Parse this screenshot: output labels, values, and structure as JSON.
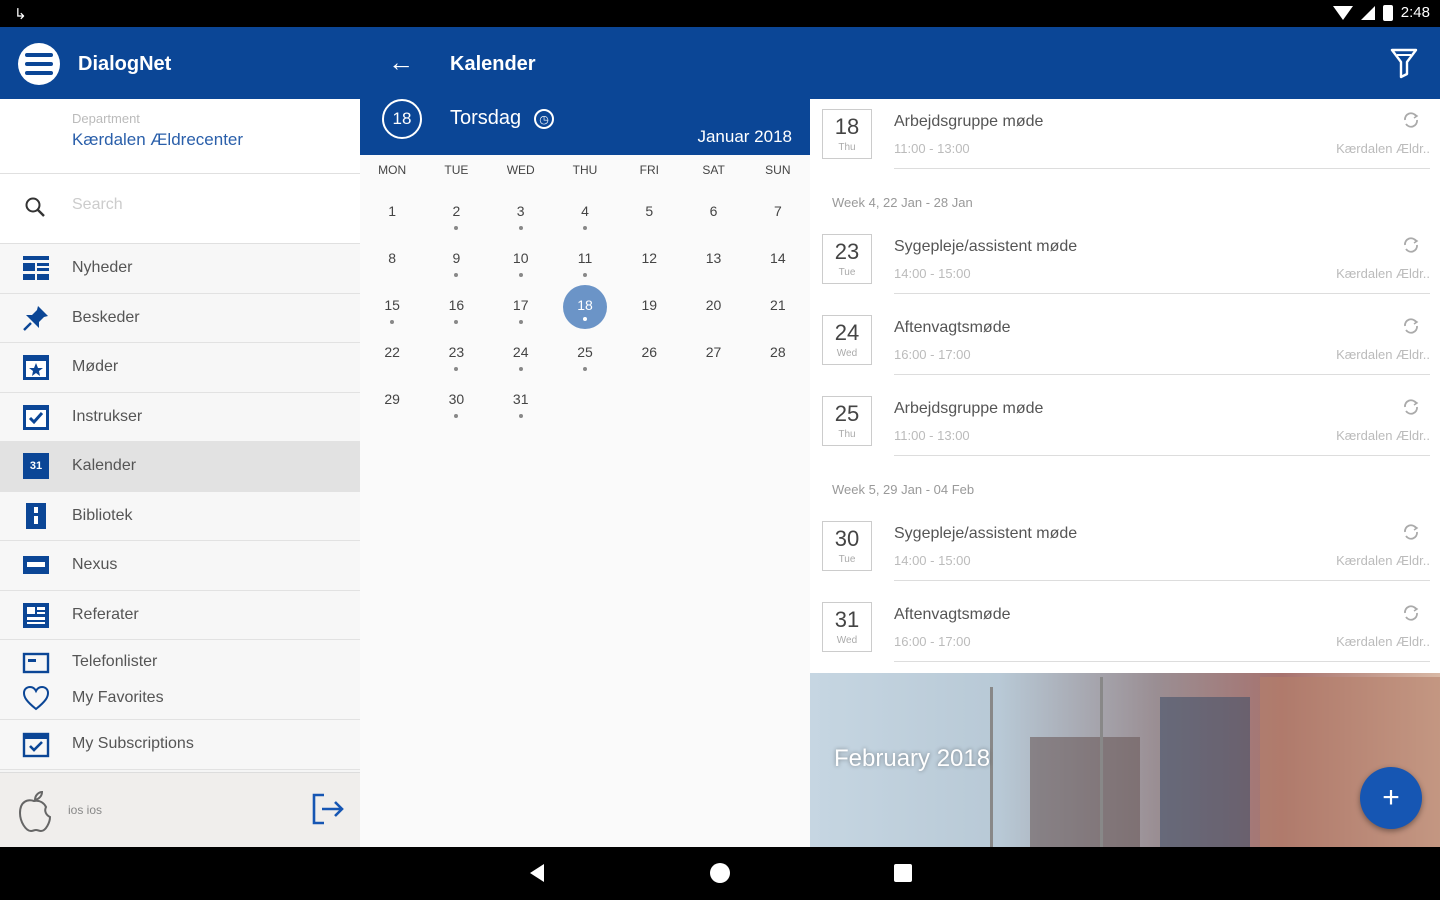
{
  "status": {
    "time": "2:48"
  },
  "app": {
    "name": "DialogNet",
    "page_title": "Kalender"
  },
  "sidebar": {
    "department_label": "Department",
    "department_value": "Kærdalen Ældrecenter",
    "search_placeholder": "Search",
    "items": [
      {
        "label": "Nyheder"
      },
      {
        "label": "Beskeder"
      },
      {
        "label": "Møder"
      },
      {
        "label": "Instrukser"
      },
      {
        "label": "Kalender",
        "active": true
      },
      {
        "label": "Bibliotek"
      },
      {
        "label": "Nexus"
      },
      {
        "label": "Referater"
      },
      {
        "label": "Telefonlister"
      },
      {
        "label": "My Favorites"
      },
      {
        "label": "My Subscriptions"
      }
    ],
    "user_name": "ios ios"
  },
  "calendar": {
    "selected_day": "18",
    "weekday": "Torsdag",
    "month": "Januar 2018",
    "dow": [
      "MON",
      "TUE",
      "WED",
      "THU",
      "FRI",
      "SAT",
      "SUN"
    ],
    "days": [
      {
        "d": "1",
        "dot": false
      },
      {
        "d": "2",
        "dot": true
      },
      {
        "d": "3",
        "dot": true
      },
      {
        "d": "4",
        "dot": true
      },
      {
        "d": "5",
        "dot": false
      },
      {
        "d": "6",
        "dot": false
      },
      {
        "d": "7",
        "dot": false
      },
      {
        "d": "8",
        "dot": false
      },
      {
        "d": "9",
        "dot": true
      },
      {
        "d": "10",
        "dot": true
      },
      {
        "d": "11",
        "dot": true
      },
      {
        "d": "12",
        "dot": false
      },
      {
        "d": "13",
        "dot": false
      },
      {
        "d": "14",
        "dot": false
      },
      {
        "d": "15",
        "dot": true
      },
      {
        "d": "16",
        "dot": true
      },
      {
        "d": "17",
        "dot": true
      },
      {
        "d": "18",
        "dot": true,
        "selected": true
      },
      {
        "d": "19",
        "dot": false
      },
      {
        "d": "20",
        "dot": false
      },
      {
        "d": "21",
        "dot": false
      },
      {
        "d": "22",
        "dot": false
      },
      {
        "d": "23",
        "dot": true
      },
      {
        "d": "24",
        "dot": true
      },
      {
        "d": "25",
        "dot": true
      },
      {
        "d": "26",
        "dot": false
      },
      {
        "d": "27",
        "dot": false
      },
      {
        "d": "28",
        "dot": false
      },
      {
        "d": "29",
        "dot": false
      },
      {
        "d": "30",
        "dot": true
      },
      {
        "d": "31",
        "dot": true
      }
    ]
  },
  "events": {
    "week_headers": [
      "Week 4, 22 Jan - 28 Jan",
      "Week 5, 29 Jan - 04 Feb"
    ],
    "items": [
      {
        "day": "18",
        "wd": "Thu",
        "title": "Arbejdsgruppe møde",
        "time": "11:00 - 13:00",
        "location": "Kærdalen Ældr.."
      },
      {
        "day": "23",
        "wd": "Tue",
        "title": "Sygepleje/assistent møde",
        "time": "14:00 - 15:00",
        "location": "Kærdalen Ældr.."
      },
      {
        "day": "24",
        "wd": "Wed",
        "title": "Aftenvagtsmøde",
        "time": "16:00 - 17:00",
        "location": "Kærdalen Ældr.."
      },
      {
        "day": "25",
        "wd": "Thu",
        "title": "Arbejdsgruppe møde",
        "time": "11:00 - 13:00",
        "location": "Kærdalen Ældr.."
      },
      {
        "day": "30",
        "wd": "Tue",
        "title": "Sygepleje/assistent møde",
        "time": "14:00 - 15:00",
        "location": "Kærdalen Ældr.."
      },
      {
        "day": "31",
        "wd": "Wed",
        "title": "Aftenvagtsmøde",
        "time": "16:00 - 17:00",
        "location": "Kærdalen Ældr.."
      }
    ],
    "banner_label": "February 2018"
  },
  "colors": {
    "primary": "#0b4696",
    "selected_day": "#6b94c7",
    "fab": "#1656b3"
  },
  "icons": {
    "sidebar": [
      "news-icon",
      "pin-icon",
      "meeting-icon",
      "checklist-icon",
      "calendar-icon",
      "library-icon",
      "nexus-icon",
      "minutes-icon",
      "phonebook-icon",
      "heart-icon",
      "subscriptions-icon"
    ]
  }
}
